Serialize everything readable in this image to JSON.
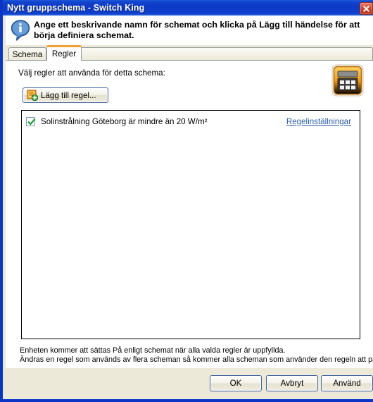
{
  "window": {
    "title": "Nytt gruppschema - Switch King",
    "close_icon": "close-icon"
  },
  "header": {
    "info_icon": "info-icon",
    "message": "Ange ett beskrivande namn för schemat och klicka på Lägg till händelse för att börja definiera schemat."
  },
  "tabs": [
    {
      "label": "Schema",
      "active": false
    },
    {
      "label": "Regler",
      "active": true
    }
  ],
  "main": {
    "field_label": "Välj regler att använda för detta schema:",
    "calendar_icon": "calendar-icon",
    "add_rule_button": {
      "label": "Lägg till regel...",
      "icon": "add-rule-icon"
    },
    "rules": [
      {
        "checked": true,
        "text": "Solinstrålning Göteborg är mindre än 20 W/m²",
        "link": "Regelinställningar"
      }
    ],
    "footnotes": [
      "Enheten kommer att sättas På enligt schemat när alla valda regler är uppfyllda.",
      "Ändras en regel som används av flera scheman så kommer alla scheman som använder den regeln att påverkas."
    ]
  },
  "footer_buttons": {
    "ok": "OK",
    "cancel": "Avbryt",
    "apply": "Använd"
  },
  "colors": {
    "titlebar_blue": "#0d39c6",
    "dialog_bg": "#ece9d8",
    "tab_accent": "#f0a030",
    "link_blue": "#2b5eac",
    "check_green": "#1e9e35",
    "icon_orange": "#f5a623"
  }
}
